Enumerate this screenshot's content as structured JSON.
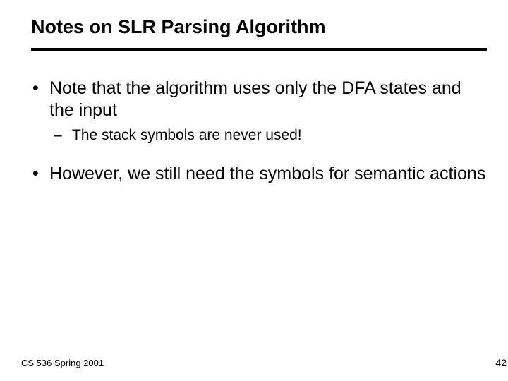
{
  "title": "Notes on SLR Parsing Algorithm",
  "bullets": {
    "0": {
      "text": "Note that the algorithm uses only the DFA states and the input",
      "sub": {
        "0": "The stack symbols are never used!"
      }
    },
    "1": {
      "text": "However, we still need the symbols for semantic actions"
    }
  },
  "footer": {
    "left": "CS 536  Spring 2001",
    "right": "42"
  }
}
